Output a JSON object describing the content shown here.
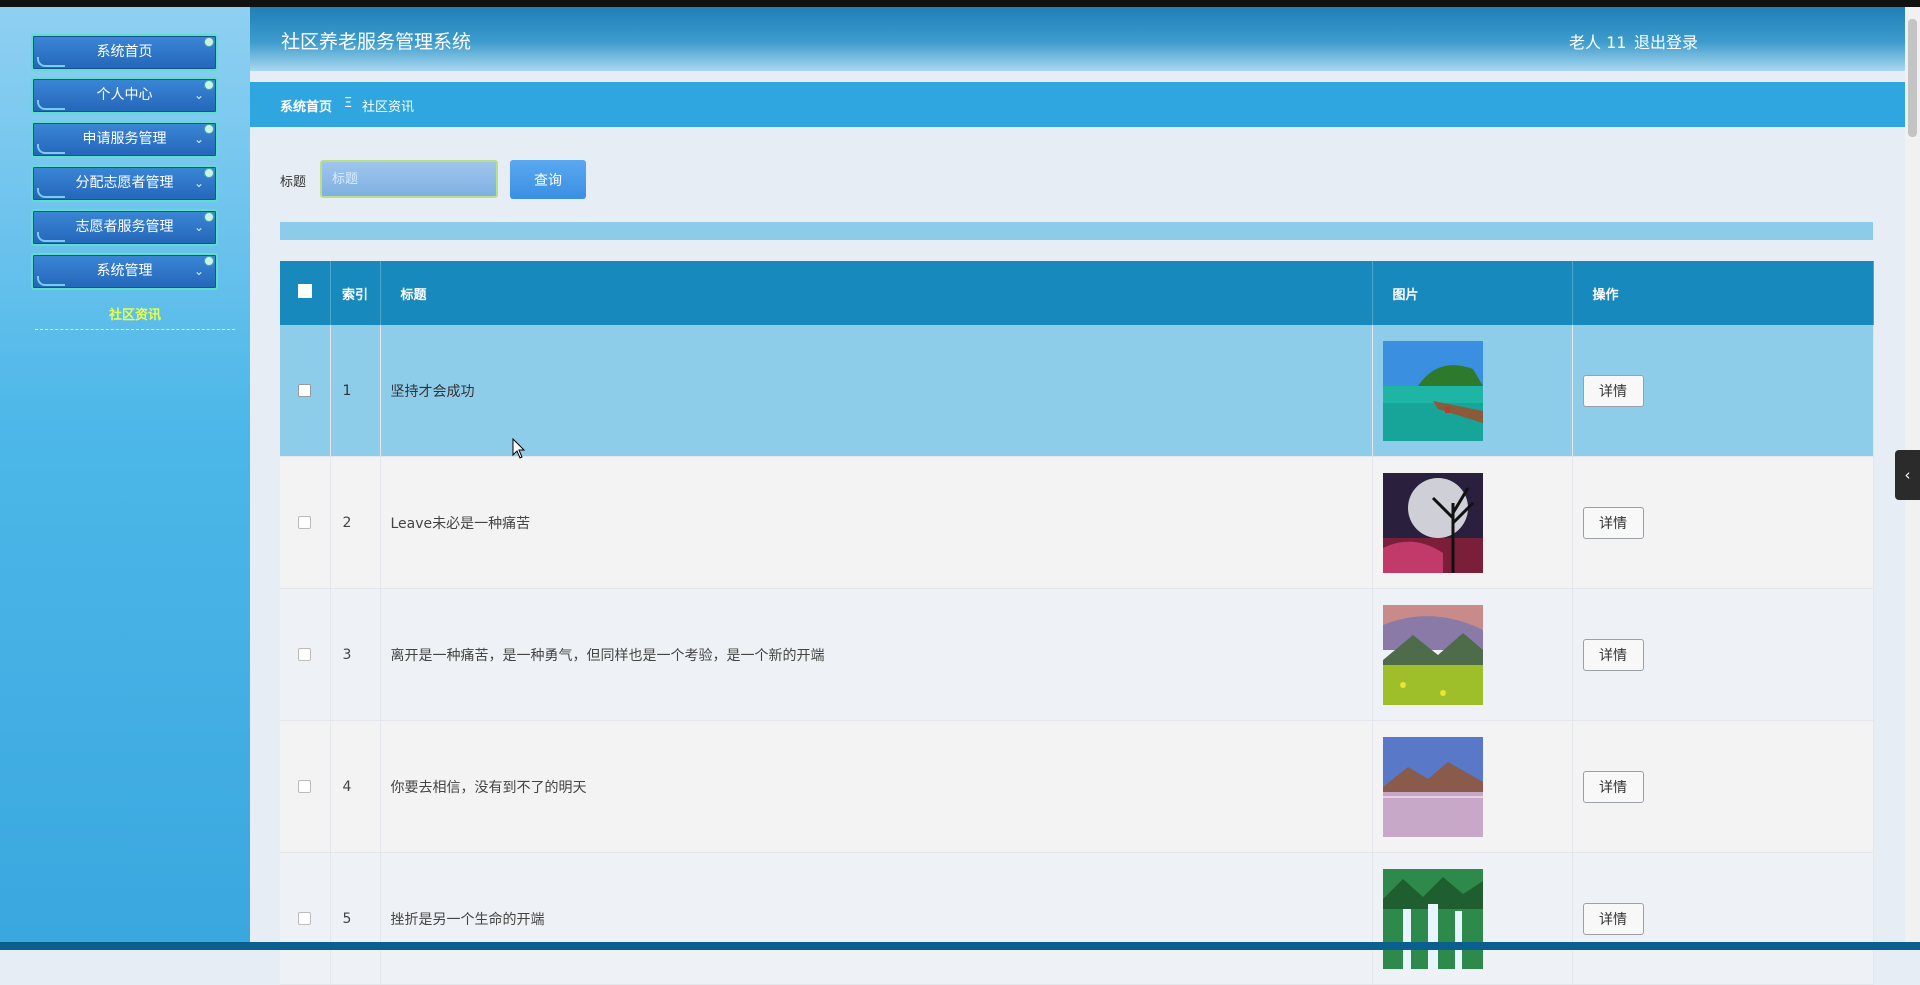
{
  "sidebar": {
    "menu": [
      {
        "label": "系统首页"
      },
      {
        "label": "个人中心"
      },
      {
        "label": "申请服务管理"
      },
      {
        "label": "分配志愿者管理"
      },
      {
        "label": "志愿者服务管理"
      },
      {
        "label": "系统管理"
      }
    ],
    "submenu_active": "社区资讯"
  },
  "header": {
    "title": "社区养老服务管理系统",
    "user": "老人 11",
    "logout": "退出登录"
  },
  "breadcrumb": {
    "home": "系统首页",
    "separator": "Ξ",
    "current": "社区资讯"
  },
  "search": {
    "label": "标题",
    "placeholder": "标题",
    "button": "查询"
  },
  "table": {
    "columns": {
      "index": "索引",
      "title": "标题",
      "image": "图片",
      "action": "操作"
    },
    "rows": [
      {
        "index": "1",
        "title": "坚持才会成功",
        "image": "island-pier-photo",
        "action": "详情"
      },
      {
        "index": "2",
        "title": "Leave未必是一种痛苦",
        "image": "moon-tree-photo",
        "action": "详情"
      },
      {
        "index": "3",
        "title": "离开是一种痛苦，是一种勇气，但同样也是一个考验，是一个新的开端",
        "image": "mountain-meadow-photo",
        "action": "详情"
      },
      {
        "index": "4",
        "title": "你要去相信，没有到不了的明天",
        "image": "lake-mountain-photo",
        "action": "详情"
      },
      {
        "index": "5",
        "title": "挫折是另一个生命的开端",
        "image": "waterfall-photo",
        "action": "详情"
      }
    ]
  },
  "colors": {
    "header": "#2a8bc1",
    "breadcrumb": "#2fa6e0",
    "table_header": "#1789bc",
    "row_highlight": "#8ecde9",
    "submenu_active": "#e8ff4a"
  }
}
